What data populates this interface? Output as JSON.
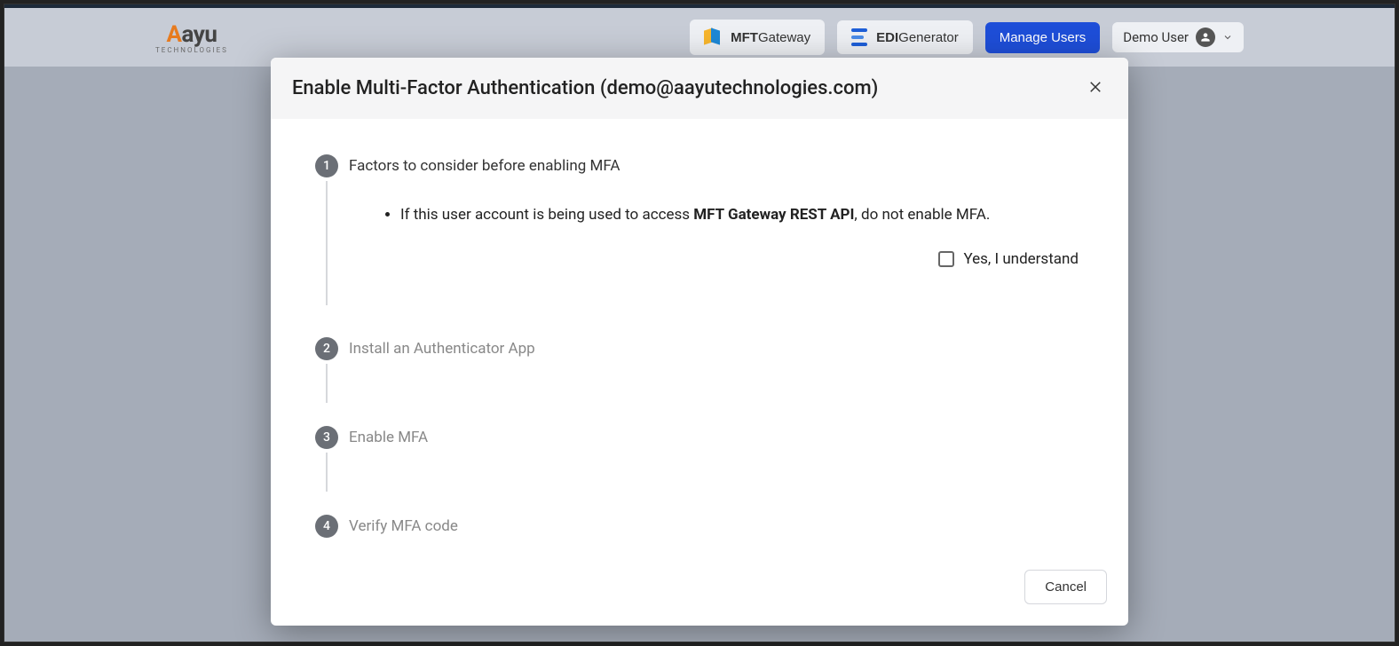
{
  "logo": {
    "main_a": "A",
    "main_rest": "ayu",
    "sub": "TECHNOLOGIES"
  },
  "header": {
    "mft_bold": "MFT",
    "mft_rest": "Gateway",
    "edi_bold": "EDI",
    "edi_rest": "Generator",
    "manage_users": "Manage Users",
    "user_name": "Demo User"
  },
  "modal": {
    "title": "Enable Multi-Factor Authentication (demo@aayutechnologies.com)",
    "steps": {
      "s1": {
        "num": "1",
        "label": "Factors to consider before enabling MFA"
      },
      "s2": {
        "num": "2",
        "label": "Install an Authenticator App"
      },
      "s3": {
        "num": "3",
        "label": "Enable MFA"
      },
      "s4": {
        "num": "4",
        "label": "Verify MFA code"
      }
    },
    "bullet_pre": "If this user account is being used to access ",
    "bullet_bold": "MFT Gateway REST API",
    "bullet_post": ", do not enable MFA.",
    "ack_label": "Yes, I understand",
    "cancel": "Cancel"
  }
}
